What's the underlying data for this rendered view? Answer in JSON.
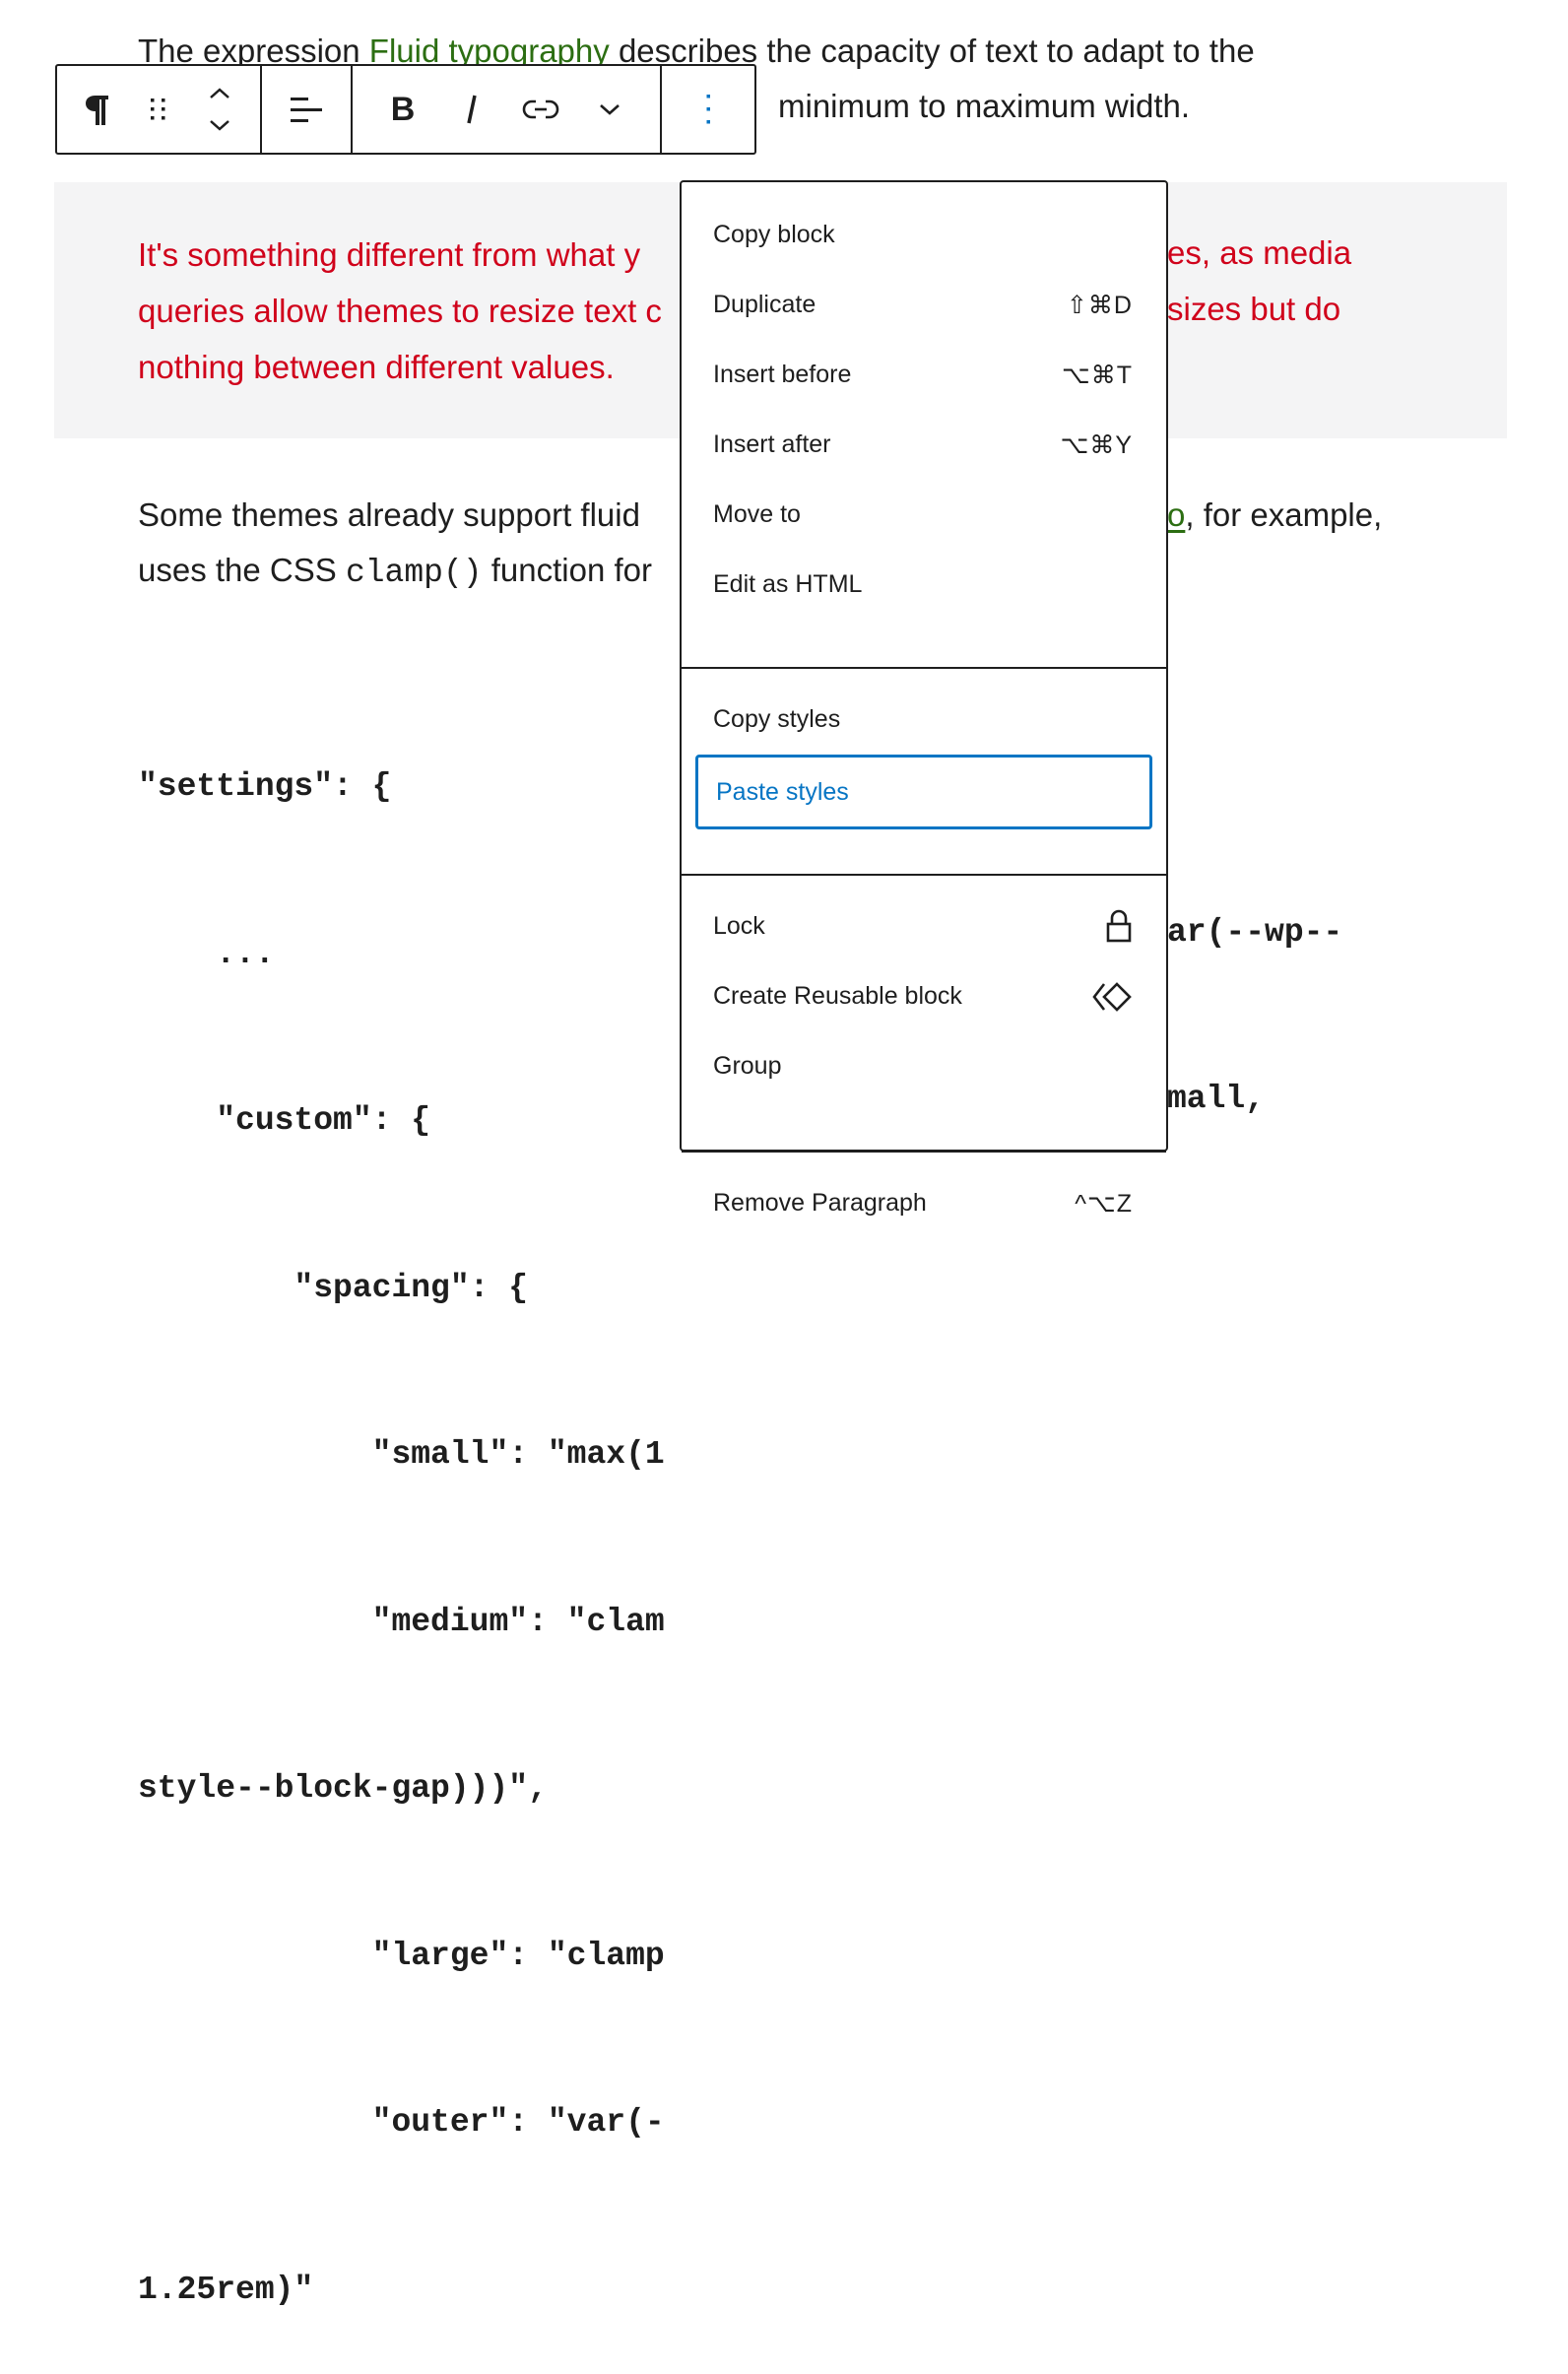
{
  "content": {
    "para1": {
      "before_link": "The expression ",
      "link": "Fluid typography",
      "after_link": " describes the capacity of text to adapt to the",
      "line2": "minimum to maximum width."
    },
    "quote": {
      "lines": [
        "It's something different from what y",
        "queries allow themes to resize text c",
        "nothing between different values."
      ],
      "right_lines": [
        "es, as media",
        "sizes but do"
      ]
    },
    "para2": {
      "line1": "Some themes already support fluid",
      "line1_right_link": "o",
      "line1_right": ", for example,",
      "line2_before": "uses the CSS ",
      "line2_code": "clamp()",
      "line2_after": " function for"
    },
    "code_lines": [
      "\"settings\": {",
      "    ...",
      "    \"custom\": {",
      "        \"spacing\": {",
      "            \"small\": \"max(1",
      "            \"medium\": \"clam",
      "style--block-gap)))\",",
      "            \"large\": \"clamp",
      "            \"outer\": \"var(-",
      "1.25rem)\""
    ],
    "code_right": {
      "medium": "ar(--wp--",
      "outer": "mall,"
    }
  },
  "toolbar": {
    "buttons": [
      {
        "name": "paragraph",
        "icon": "pilcrow-icon",
        "label": "Paragraph"
      },
      {
        "name": "drag",
        "icon": "drag-handle-icon",
        "label": "Drag"
      },
      {
        "name": "move",
        "icon": "move-up-down-icon",
        "label": "Move up / down"
      },
      {
        "name": "align",
        "icon": "align-left-icon",
        "label": "Align text"
      },
      {
        "name": "bold",
        "icon": "bold-icon",
        "label": "B"
      },
      {
        "name": "italic",
        "icon": "italic-icon",
        "label": "I"
      },
      {
        "name": "link",
        "icon": "link-icon",
        "label": "Link"
      },
      {
        "name": "more-formatting",
        "icon": "chevron-down-icon",
        "label": "More"
      },
      {
        "name": "options",
        "icon": "more-vertical-icon",
        "label": "Options"
      }
    ],
    "accent": "#0675c4"
  },
  "menu": {
    "sections": [
      {
        "items": [
          {
            "label": "Copy block",
            "shortcut": ""
          },
          {
            "label": "Duplicate",
            "shortcut": "⇧⌘D"
          },
          {
            "label": "Insert before",
            "shortcut": "⌥⌘T"
          },
          {
            "label": "Insert after",
            "shortcut": "⌥⌘Y"
          },
          {
            "label": "Move to",
            "shortcut": ""
          },
          {
            "label": "Edit as HTML",
            "shortcut": ""
          }
        ]
      },
      {
        "items": [
          {
            "label": "Copy styles",
            "shortcut": ""
          },
          {
            "label": "Paste styles",
            "shortcut": "",
            "focused": true
          }
        ]
      },
      {
        "items": [
          {
            "label": "Lock",
            "icon": "lock-icon"
          },
          {
            "label": "Create Reusable block",
            "icon": "reusable-block-icon"
          },
          {
            "label": "Group",
            "icon": ""
          }
        ]
      },
      {
        "items": [
          {
            "label": "Remove Paragraph",
            "shortcut": "^⌥Z"
          }
        ]
      }
    ]
  },
  "colors": {
    "link": "#2c6e12",
    "quote_text": "#d0021b",
    "quote_bg": "#f4f4f5",
    "focus": "#0675c4"
  }
}
